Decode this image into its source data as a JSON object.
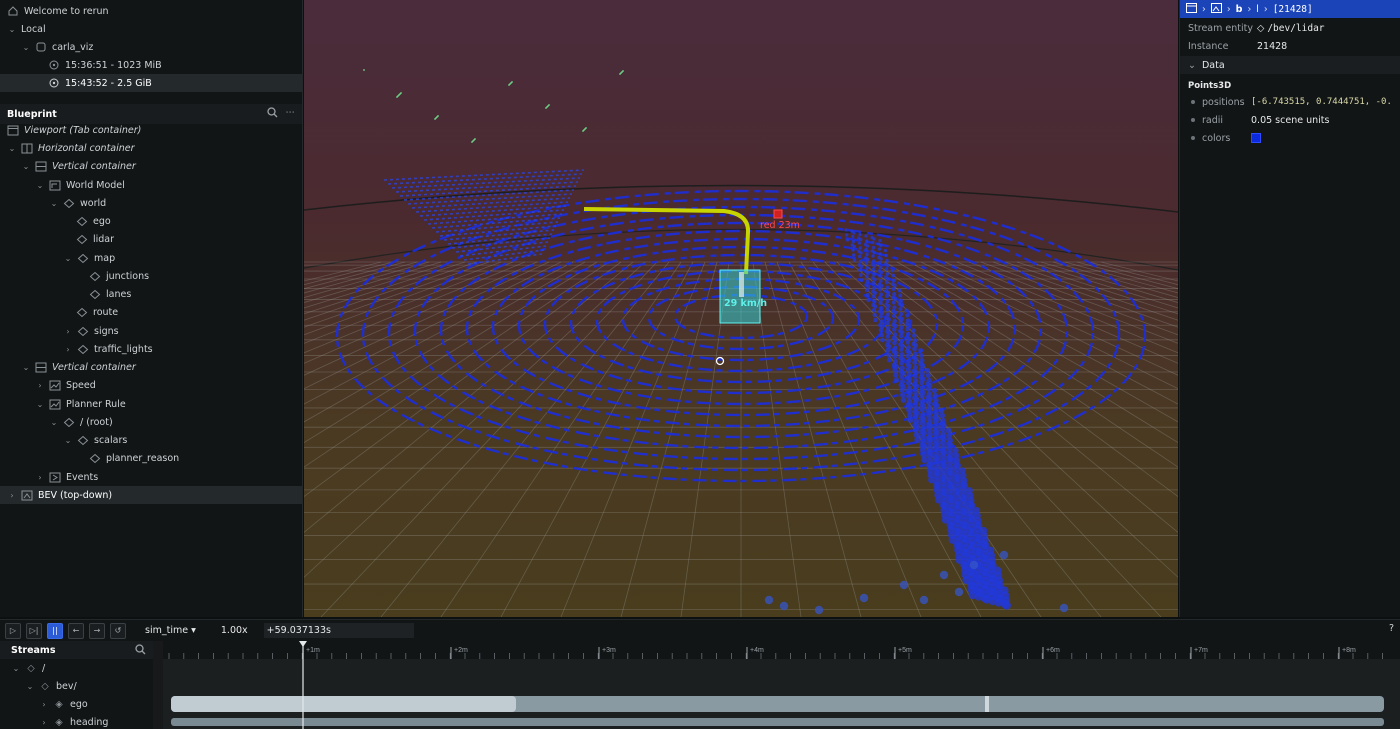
{
  "recordings": {
    "welcome": "Welcome to rerun",
    "local": "Local",
    "app": "carla_viz",
    "items": [
      "15:36:51 - 1023 MiB",
      "15:43:52 - 2.5 GiB"
    ]
  },
  "blueprint": {
    "title": "Blueprint",
    "tree": [
      {
        "label": "Viewport (Tab container)",
        "italic": true,
        "icon": "viewport-icon"
      },
      {
        "label": "Horizontal container",
        "italic": true,
        "icon": "horizontal-icon"
      },
      {
        "label": "Vertical container",
        "italic": true,
        "icon": "vertical-icon"
      },
      {
        "label": "World Model",
        "icon": "view3d-icon"
      },
      {
        "label": "world",
        "icon": "entity-icon"
      },
      {
        "label": "ego",
        "icon": "entity-icon"
      },
      {
        "label": "lidar",
        "icon": "entity-icon"
      },
      {
        "label": "map",
        "icon": "entity-icon"
      },
      {
        "label": "junctions",
        "icon": "entity-icon"
      },
      {
        "label": "lanes",
        "icon": "entity-icon"
      },
      {
        "label": "route",
        "icon": "entity-icon"
      },
      {
        "label": "signs",
        "icon": "entity-icon"
      },
      {
        "label": "traffic_lights",
        "icon": "entity-icon"
      },
      {
        "label": "Vertical container",
        "italic": true,
        "icon": "vertical-icon"
      },
      {
        "label": "Speed",
        "icon": "timeseries-icon"
      },
      {
        "label": "Planner Rule",
        "icon": "timeseries-icon"
      },
      {
        "label": "/ (root)",
        "icon": "entity-icon"
      },
      {
        "label": "scalars",
        "icon": "entity-icon"
      },
      {
        "label": "planner_reason",
        "icon": "entity-icon"
      },
      {
        "label": "Events",
        "icon": "text-icon"
      },
      {
        "label": "BEV (top-down)",
        "icon": "view2d-icon"
      }
    ]
  },
  "viewport": {
    "speed_label": "29 km/h",
    "light_label": "red 23m"
  },
  "selection": {
    "crumbs": [
      "b",
      "l",
      "[21428]"
    ],
    "stream_entity_label": "Stream entity",
    "stream_entity_value": "/bev/lidar",
    "instance_label": "Instance",
    "instance_value": "21428",
    "data_label": "Data",
    "archetype": "Points3D",
    "components": [
      {
        "name": "positions",
        "value": "[-6.743515, 0.7444751, -0.",
        "mono": true
      },
      {
        "name": "radii",
        "value": "0.05 scene units"
      },
      {
        "name": "colors",
        "value": "",
        "color": "#0b2bdc"
      }
    ]
  },
  "time_panel": {
    "timeline": "sim_time",
    "speed": "1.00x",
    "current_time": "+59.037133s",
    "help": "?",
    "ticks": [
      "+1m",
      "+2m",
      "+3m",
      "+4m",
      "+5m",
      "+6m",
      "+7m",
      "+8m"
    ]
  },
  "streams": {
    "title": "Streams",
    "items": [
      "/",
      "bev/",
      "ego",
      "heading"
    ]
  }
}
